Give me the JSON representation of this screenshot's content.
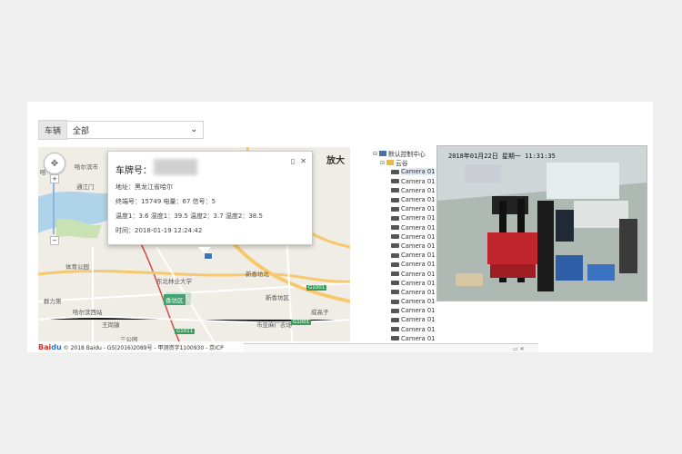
{
  "filter": {
    "label": "车辆",
    "selected": "全部"
  },
  "map": {
    "zoom_text": "放大",
    "labels": {
      "haerbin_north": "哈尔滨市",
      "haerbin_left": "哈",
      "tongjiang": "通江门",
      "park": "体育公园",
      "lane": "群力第",
      "institute": "哈尔滨西站",
      "wangzhou": "王岗镇",
      "park2": "三公园",
      "univ": "东北林业大学",
      "xiangfang": "香坊区",
      "xiangfang_area": "新香坊北",
      "xiangfang_south": "新香坊区",
      "jiao": "成高子",
      "jiang": "哈尔滨工业",
      "factory": "市亚麻厂农场"
    },
    "badges": [
      "G1001",
      "G1001",
      "G1011"
    ],
    "copyright": "© 2018 Baidu - GS(2016)2089号 - 甲测资字1100930 - 京ICP"
  },
  "popup": {
    "title": "车牌号：",
    "address": "地址：黑龙江省哈尔",
    "terminal": "终端号：15749 电量：67 信号：5",
    "temperature": "温度1：3.6 湿度1：39.5 温度2：3.7 湿度2：38.5",
    "time": "时间：2018-01-19 12:24:42"
  },
  "tree": {
    "root": "默认控制中心",
    "group": "云谷",
    "camera_label": "Camera 01",
    "camera_count": 20
  },
  "video": {
    "osd": "2018年01月22日 星期一 11:31:35"
  },
  "colors": {
    "road": "#f6c96c",
    "river": "#a7cfe8",
    "district": "#45a071"
  }
}
